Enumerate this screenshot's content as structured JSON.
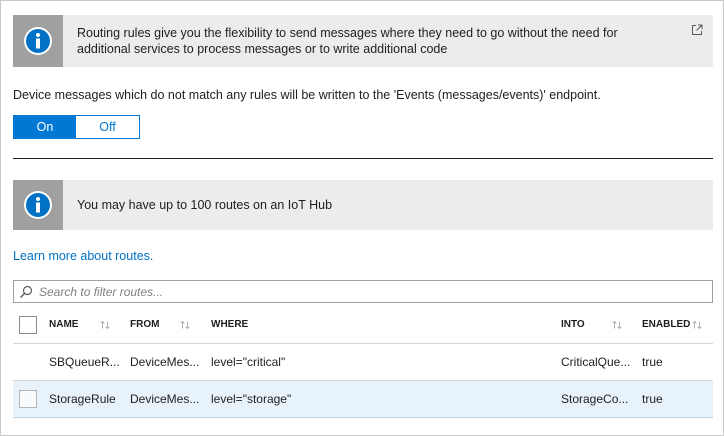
{
  "banner_routing": {
    "text": "Routing rules give you the flexibility to send messages where they need to go without the need for additional services to process messages or to write additional code",
    "icon": "info-icon",
    "external_icon": "external-link-icon"
  },
  "fallback": {
    "description": "Device messages which do not match any rules will be written to the 'Events (messages/events)' endpoint.",
    "toggle_on": "On",
    "toggle_off": "Off",
    "selected": "On"
  },
  "banner_limit": {
    "text": "You may have up to 100 routes on an IoT Hub",
    "icon": "info-icon"
  },
  "learn_more": "Learn more about routes.",
  "search": {
    "placeholder": "Search to filter routes...",
    "value": ""
  },
  "table": {
    "columns": {
      "name": "NAME",
      "from": "FROM",
      "where": "WHERE",
      "into": "INTO",
      "enabled": "ENABLED"
    },
    "rows": [
      {
        "name": "SBQueueR...",
        "from": "DeviceMes...",
        "where": "level=\"critical\"",
        "into": "CriticalQue...",
        "enabled": "true"
      },
      {
        "name": "StorageRule",
        "from": "DeviceMes...",
        "where": "level=\"storage\"",
        "into": "StorageCo...",
        "enabled": "true"
      }
    ]
  },
  "colors": {
    "accent": "#0078d4",
    "link": "#0072c6",
    "info_banner_bg": "#ececec",
    "info_icon_bg": "#a0a0a0",
    "selected_row_bg": "#e8f2fb"
  }
}
